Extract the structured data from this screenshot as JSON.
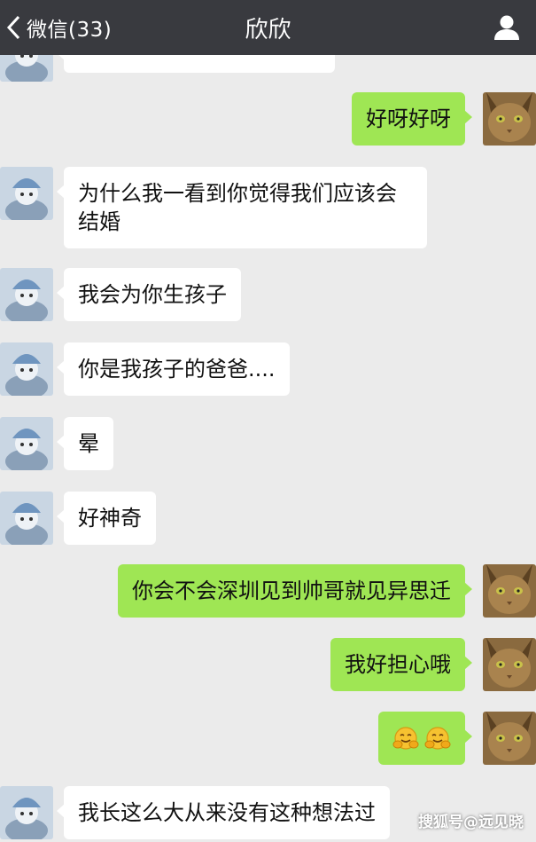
{
  "header": {
    "back_label": "微信(33)",
    "title": "欣欣",
    "back_icon": "chevron-left-icon",
    "profile_icon": "person-icon"
  },
  "colors": {
    "topbar": "#393a3f",
    "background": "#ebebeb",
    "sent_bubble": "#9fe654",
    "received_bubble": "#ffffff"
  },
  "messages": [
    {
      "side": "left",
      "text": ""
    },
    {
      "side": "right",
      "text": "好呀好呀"
    },
    {
      "side": "left",
      "text": "为什么我一看到你觉得我们应该会结婚"
    },
    {
      "side": "left",
      "text": "我会为你生孩子"
    },
    {
      "side": "left",
      "text": "你是我孩子的爸爸...."
    },
    {
      "side": "left",
      "text": "晕"
    },
    {
      "side": "left",
      "text": "好神奇"
    },
    {
      "side": "right",
      "text": "你会不会深圳见到帅哥就见异思迁"
    },
    {
      "side": "right",
      "text": "我好担心哦"
    },
    {
      "side": "right",
      "text": "",
      "emoji": [
        "hugging-emoji",
        "hugging-emoji"
      ]
    },
    {
      "side": "left",
      "text": "我长这么大从来没有这种想法过"
    }
  ],
  "watermark": "搜狐号@远见晓"
}
